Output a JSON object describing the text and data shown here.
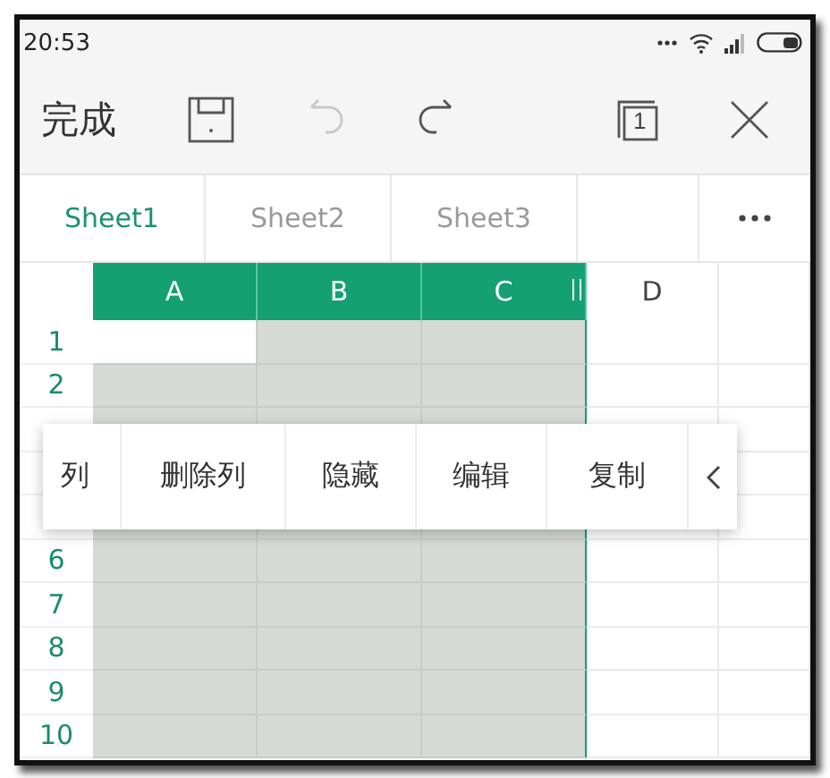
{
  "status_bar": {
    "time": "20:53"
  },
  "toolbar": {
    "done": "完成",
    "undo": {
      "disabled": true
    },
    "redo": {
      "disabled": false
    },
    "sheet_count": "1"
  },
  "tabs": [
    {
      "label": "Sheet1",
      "selected": true
    },
    {
      "label": "Sheet2",
      "selected": false
    },
    {
      "label": "Sheet3",
      "selected": false
    }
  ],
  "grid": {
    "columns": [
      {
        "label": "A",
        "selected": true,
        "active": true
      },
      {
        "label": "B",
        "selected": true,
        "active": false
      },
      {
        "label": "C",
        "selected": true,
        "active": false
      },
      {
        "label": "D",
        "selected": false,
        "active": false
      }
    ],
    "rows": [
      {
        "label": "1",
        "active": true
      },
      {
        "label": "2",
        "active": false
      },
      {
        "active": false
      },
      {},
      {
        "active": false
      },
      {
        "label": "6",
        "active": false
      },
      {
        "label": "7",
        "active": false
      },
      {
        "label": "8",
        "active": false
      },
      {
        "label": "9",
        "active": false
      },
      {
        "label": "10",
        "active": false
      }
    ]
  },
  "context_menu": {
    "items": [
      {
        "label": "列"
      },
      {
        "label": "删除列"
      },
      {
        "label": "隐藏"
      },
      {
        "label": "编辑"
      },
      {
        "label": "复制"
      }
    ]
  }
}
